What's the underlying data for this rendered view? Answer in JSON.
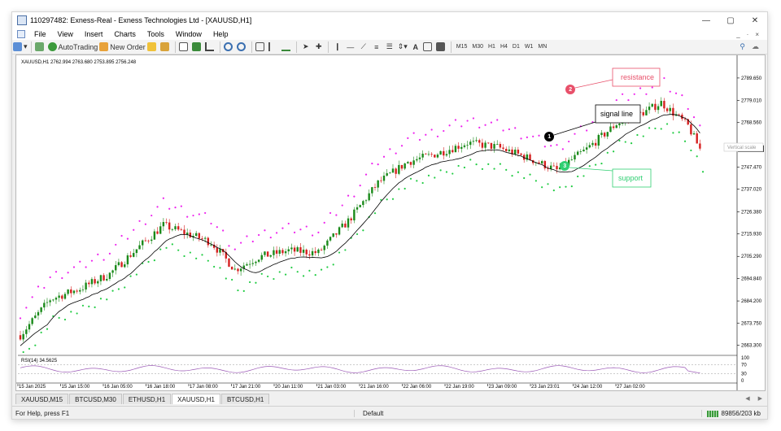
{
  "window": {
    "title": "110297482: Exness-Real - Exness Technologies Ltd - [XAUUSD,H1]",
    "controls": [
      "—",
      "▢",
      "✕"
    ]
  },
  "menu": {
    "items": [
      "File",
      "View",
      "Insert",
      "Charts",
      "Tools",
      "Window",
      "Help"
    ],
    "right": [
      "_",
      "·",
      "×"
    ]
  },
  "toolbar": {
    "autotrading": "AutoTrading",
    "new_order": "New Order",
    "text_tool": "A",
    "timeframes": [
      "M15",
      "M30",
      "H1",
      "H4",
      "D1",
      "W1",
      "MN"
    ]
  },
  "chart": {
    "symbol_info": "XAUUSD,H1  2762.994 2763.680 2753.895 2756.248",
    "current_price": "2756.248",
    "scale_tooltip": "Vertical scale",
    "rsi_label": "RSI(14) 34.5625",
    "rsi_levels": [
      "100",
      "70",
      "30",
      "0"
    ],
    "annotations": {
      "resistance": {
        "label": "resistance",
        "number": "2",
        "color": "#e8506a"
      },
      "signal": {
        "label": "signal line",
        "number": "1",
        "color": "#000000"
      },
      "support": {
        "label": "support",
        "number": "3",
        "color": "#2fcf72"
      }
    },
    "colors": {
      "bull": "#1a8a1a",
      "bear": "#d62020",
      "upper_dots": "#ee22ee",
      "lower_dots": "#22cc44",
      "signal": "#000000",
      "rsi": "#9b59b6"
    }
  },
  "chart_data": {
    "type": "candlestick",
    "y_ticks": [
      "2789.650",
      "2779.010",
      "2768.560",
      "2757.920",
      "2747.470",
      "2737.020",
      "2726.380",
      "2715.930",
      "2705.290",
      "2694.840",
      "2684.200",
      "2673.750",
      "2663.300"
    ],
    "x_ticks": [
      "15 Jan 2025",
      "15 Jan 15:00",
      "16 Jan 05:00",
      "16 Jan 18:00",
      "17 Jan 08:00",
      "17 Jan 21:00",
      "20 Jan 11:00",
      "21 Jan 03:00",
      "21 Jan 16:00",
      "22 Jan 06:00",
      "22 Jan 19:00",
      "23 Jan 09:00",
      "23 Jan 23:01",
      "24 Jan 12:00",
      "27 Jan 02:00"
    ],
    "ylim": [
      2660,
      2795
    ],
    "trend_anchors": [
      [
        0,
        2668
      ],
      [
        10,
        2685
      ],
      [
        20,
        2690
      ],
      [
        30,
        2697
      ],
      [
        40,
        2710
      ],
      [
        48,
        2720
      ],
      [
        56,
        2716
      ],
      [
        64,
        2712
      ],
      [
        72,
        2699
      ],
      [
        80,
        2705
      ],
      [
        90,
        2708
      ],
      [
        100,
        2707
      ],
      [
        110,
        2722
      ],
      [
        120,
        2740
      ],
      [
        130,
        2750
      ],
      [
        140,
        2754
      ],
      [
        150,
        2759
      ],
      [
        160,
        2757
      ],
      [
        170,
        2752
      ],
      [
        180,
        2746
      ],
      [
        190,
        2756
      ],
      [
        200,
        2768
      ],
      [
        210,
        2774
      ],
      [
        215,
        2778
      ],
      [
        220,
        2772
      ],
      [
        224,
        2767
      ],
      [
        228,
        2756
      ]
    ],
    "candle_count": 229
  },
  "tabs": [
    "XAUUSD,M15",
    "BTCUSD,M30",
    "ETHUSD,H1",
    "XAUUSD,H1",
    "BTCUSD,H1"
  ],
  "active_tab": "XAUUSD,H1",
  "status": {
    "help": "For Help, press F1",
    "profile": "Default",
    "connection": "89856/203 kb"
  }
}
